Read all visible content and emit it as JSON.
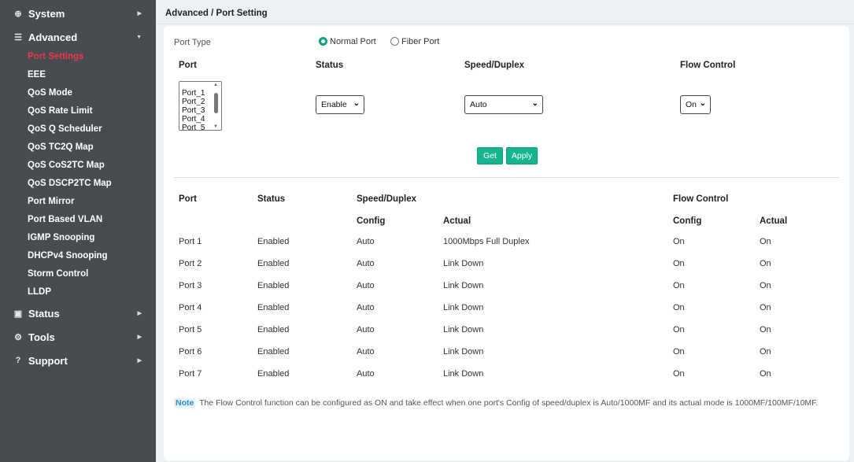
{
  "sidebar": {
    "system": "System",
    "advanced": "Advanced",
    "advanced_items": [
      "Port Settings",
      "EEE",
      "QoS Mode",
      "QoS Rate Limit",
      "QoS Q Scheduler",
      "QoS TC2Q Map",
      "QoS CoS2TC Map",
      "QoS DSCP2TC Map",
      "Port Mirror",
      "Port Based VLAN",
      "IGMP Snooping",
      "DHCPv4 Snooping",
      "Storm Control",
      "LLDP"
    ],
    "active_item": "Port Settings",
    "status": "Status",
    "tools": "Tools",
    "support": "Support"
  },
  "breadcrumb": "Advanced / Port Setting",
  "form": {
    "port_type_label": "Port Type",
    "port_type_options": [
      "Normal Port",
      "Fiber Port"
    ],
    "port_type_selected": "Normal Port",
    "col_port": "Port",
    "col_status": "Status",
    "col_speed": "Speed/Duplex",
    "col_flow": "Flow Control",
    "port_list": [
      "Port_1",
      "Port_2",
      "Port_3",
      "Port_4",
      "Port_5"
    ],
    "status_value": "Enable",
    "speed_value": "Auto",
    "flow_value": "On",
    "get_label": "Get",
    "apply_label": "Apply"
  },
  "table": {
    "headers": {
      "port": "Port",
      "status": "Status",
      "speed": "Speed/Duplex",
      "flow": "Flow Control",
      "config": "Config",
      "actual": "Actual",
      "flow_config": "Config",
      "flow_actual": "Actual"
    },
    "rows": [
      {
        "port": "Port 1",
        "status": "Enabled",
        "config": "Auto",
        "actual": "1000Mbps Full Duplex",
        "fc_config": "On",
        "fc_actual": "On"
      },
      {
        "port": "Port 2",
        "status": "Enabled",
        "config": "Auto",
        "actual": "Link Down",
        "fc_config": "On",
        "fc_actual": "On"
      },
      {
        "port": "Port 3",
        "status": "Enabled",
        "config": "Auto",
        "actual": "Link Down",
        "fc_config": "On",
        "fc_actual": "On"
      },
      {
        "port": "Port 4",
        "status": "Enabled",
        "config": "Auto",
        "actual": "Link Down",
        "fc_config": "On",
        "fc_actual": "On"
      },
      {
        "port": "Port 5",
        "status": "Enabled",
        "config": "Auto",
        "actual": "Link Down",
        "fc_config": "On",
        "fc_actual": "On"
      },
      {
        "port": "Port 6",
        "status": "Enabled",
        "config": "Auto",
        "actual": "Link Down",
        "fc_config": "On",
        "fc_actual": "On"
      },
      {
        "port": "Port 7",
        "status": "Enabled",
        "config": "Auto",
        "actual": "Link Down",
        "fc_config": "On",
        "fc_actual": "On"
      }
    ]
  },
  "note": {
    "tag": "Note",
    "text": "The Flow Control function can be configured as ON and take effect when one port's Config of speed/duplex is Auto/1000MF and its actual mode is 1000MF/100MF/10MF."
  },
  "colors": {
    "sidebar_bg": "#484b50",
    "active_item": "#e8394a",
    "accent": "#16b58f"
  },
  "icons": {
    "system": "globe-icon",
    "advanced": "sliders-icon",
    "status": "monitor-icon",
    "tools": "gear-icon",
    "support": "help-circle-icon"
  }
}
